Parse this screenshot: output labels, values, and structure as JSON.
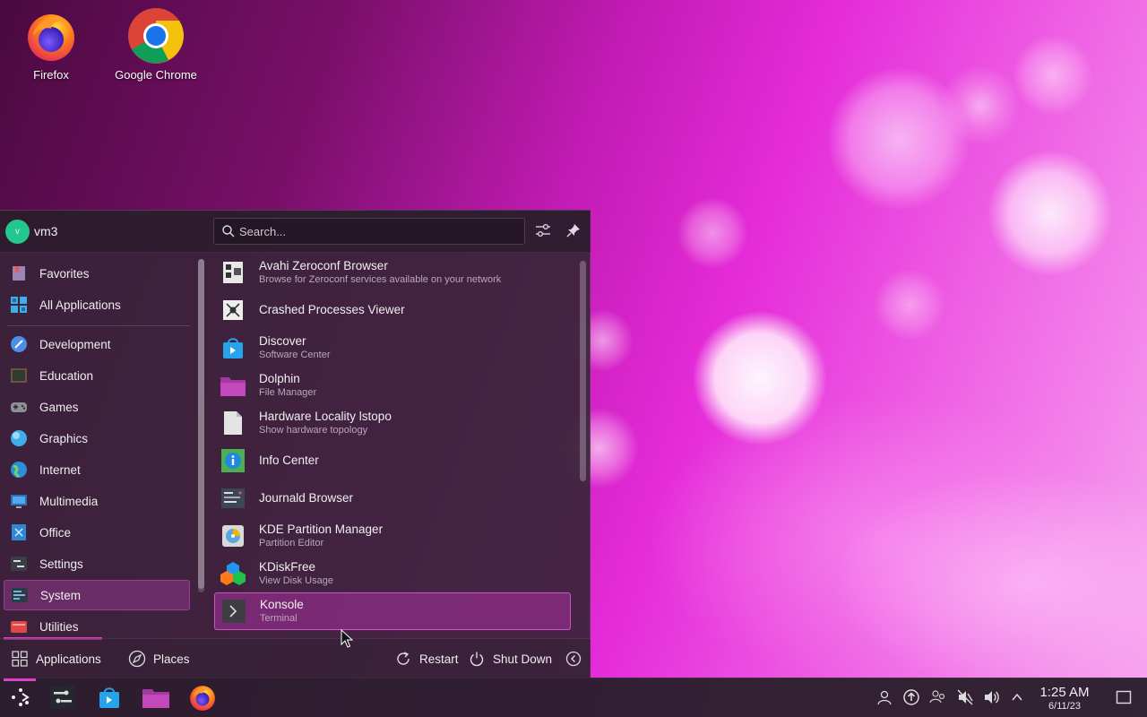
{
  "desktop": {
    "icons": [
      {
        "label": "Firefox",
        "icon": "firefox-icon"
      },
      {
        "label": "Google Chrome",
        "icon": "chrome-icon"
      }
    ]
  },
  "launcher": {
    "user": {
      "avatar_letter": "v",
      "name": "vm3"
    },
    "search": {
      "placeholder": "Search..."
    },
    "sidebar": [
      {
        "label": "Favorites",
        "icon": "favorites-icon"
      },
      {
        "label": "All Applications",
        "icon": "all-applications-icon"
      },
      {
        "label": "Development",
        "icon": "development-icon"
      },
      {
        "label": "Education",
        "icon": "education-icon"
      },
      {
        "label": "Games",
        "icon": "games-icon"
      },
      {
        "label": "Graphics",
        "icon": "graphics-icon"
      },
      {
        "label": "Internet",
        "icon": "internet-icon"
      },
      {
        "label": "Multimedia",
        "icon": "multimedia-icon"
      },
      {
        "label": "Office",
        "icon": "office-icon"
      },
      {
        "label": "Settings",
        "icon": "settings-icon"
      },
      {
        "label": "System",
        "icon": "system-icon",
        "active": true
      },
      {
        "label": "Utilities",
        "icon": "utilities-icon"
      }
    ],
    "apps": [
      {
        "name": "Avahi Zeroconf Browser",
        "desc": "Browse for Zeroconf services available on your network",
        "icon": "network-icon"
      },
      {
        "name": "Crashed Processes Viewer",
        "desc": "",
        "icon": "bug-icon"
      },
      {
        "name": "Discover",
        "desc": "Software Center",
        "icon": "discover-icon"
      },
      {
        "name": "Dolphin",
        "desc": "File Manager",
        "icon": "folder-icon"
      },
      {
        "name": "Hardware Locality lstopo",
        "desc": "Show hardware topology",
        "icon": "document-icon"
      },
      {
        "name": "Info Center",
        "desc": "",
        "icon": "info-icon"
      },
      {
        "name": "Journald Browser",
        "desc": "",
        "icon": "log-icon"
      },
      {
        "name": "KDE Partition Manager",
        "desc": "Partition Editor",
        "icon": "disk-icon"
      },
      {
        "name": "KDiskFree",
        "desc": "View Disk Usage",
        "icon": "cubes-icon"
      },
      {
        "name": "Konsole",
        "desc": "Terminal",
        "icon": "terminal-icon",
        "highlight": true
      }
    ],
    "footer": {
      "applications": "Applications",
      "places": "Places",
      "restart": "Restart",
      "shutdown": "Shut Down"
    }
  },
  "taskbar": {
    "apps": [
      "launcher-icon",
      "system-settings-icon",
      "discover-icon",
      "dolphin-icon",
      "firefox-icon"
    ],
    "tray": [
      "user-icon",
      "updates-icon",
      "network-icon",
      "mute-icon",
      "volume-icon",
      "expand-tray-icon"
    ],
    "clock": {
      "time": "1:25 AM",
      "date": "6/11/23"
    }
  },
  "colors": {
    "accent": "#e040c8",
    "panel": "#3a243a",
    "highlight": "#aa32a0"
  }
}
